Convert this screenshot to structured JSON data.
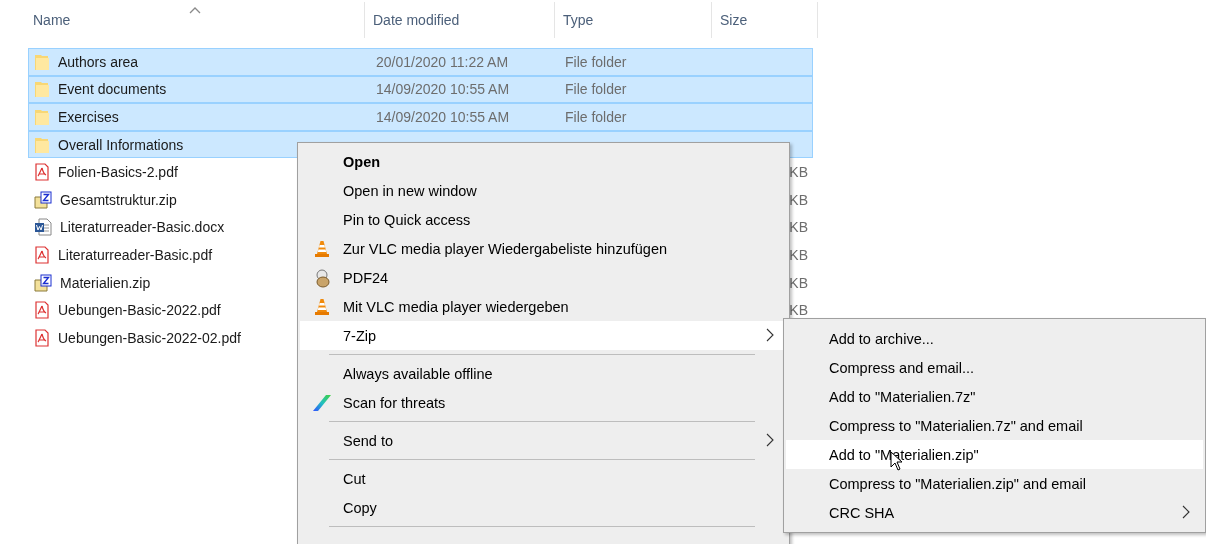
{
  "columns": [
    {
      "label": "Name",
      "sorted": true
    },
    {
      "label": "Date modified",
      "sorted": false
    },
    {
      "label": "Type",
      "sorted": false
    },
    {
      "label": "Size",
      "sorted": false
    }
  ],
  "rows": [
    {
      "kind": "folder",
      "name": "Authors area",
      "date": "20/01/2020 11:22 AM",
      "type": "File folder",
      "selected": true
    },
    {
      "kind": "folder",
      "name": "Event documents",
      "date": "14/09/2020 10:55 AM",
      "type": "File folder",
      "selected": true
    },
    {
      "kind": "folder",
      "name": "Exercises",
      "date": "14/09/2020 10:55 AM",
      "type": "File folder",
      "selected": true
    },
    {
      "kind": "folder",
      "name": "Overall Informations",
      "selected": true
    },
    {
      "kind": "pdf",
      "name": "Folien-Basics-2.pdf",
      "size": "KB",
      "selected": false
    },
    {
      "kind": "zip",
      "name": "Gesamtstruktur.zip",
      "size": "KB",
      "selected": false
    },
    {
      "kind": "word",
      "name": "Literaturreader-Basic.docx",
      "size": "KB",
      "selected": false
    },
    {
      "kind": "pdf",
      "name": "Literaturreader-Basic.pdf",
      "size": "KB",
      "selected": false
    },
    {
      "kind": "zip",
      "name": "Materialien.zip",
      "size": "KB",
      "selected": false
    },
    {
      "kind": "pdf",
      "name": "Uebungen-Basic-2022.pdf",
      "size": "KB",
      "selected": false
    },
    {
      "kind": "pdf",
      "name": "Uebungen-Basic-2022-02.pdf",
      "selected": false
    }
  ],
  "context_menu": {
    "items": [
      {
        "kind": "item",
        "label": "Open",
        "bold": true,
        "submenu": false,
        "highlighted": false
      },
      {
        "kind": "item",
        "label": "Open in new window",
        "bold": false,
        "submenu": false,
        "highlighted": false
      },
      {
        "kind": "item",
        "label": "Pin to Quick access",
        "bold": false,
        "submenu": false,
        "highlighted": false
      },
      {
        "kind": "item",
        "label": "Zur VLC media player Wiedergabeliste hinzufügen",
        "bold": false,
        "submenu": false,
        "highlighted": false
      },
      {
        "kind": "item",
        "label": "PDF24",
        "bold": false,
        "submenu": false,
        "highlighted": false
      },
      {
        "kind": "item",
        "label": "Mit VLC media player wiedergeben",
        "bold": false,
        "submenu": false,
        "highlighted": false
      },
      {
        "kind": "item",
        "label": "7-Zip",
        "bold": false,
        "submenu": true,
        "highlighted": true
      },
      {
        "kind": "separator"
      },
      {
        "kind": "item",
        "label": "Always available offline",
        "bold": false,
        "submenu": false,
        "highlighted": false
      },
      {
        "kind": "item",
        "label": "Scan for threats",
        "bold": false,
        "submenu": false,
        "highlighted": false
      },
      {
        "kind": "separator"
      },
      {
        "kind": "item",
        "label": "Send to",
        "bold": false,
        "submenu": true,
        "highlighted": false
      },
      {
        "kind": "separator"
      },
      {
        "kind": "item",
        "label": "Cut",
        "bold": false,
        "submenu": false,
        "highlighted": false
      },
      {
        "kind": "item",
        "label": "Copy",
        "bold": false,
        "submenu": false,
        "highlighted": false
      },
      {
        "kind": "separator"
      }
    ]
  },
  "submenu": {
    "items": [
      {
        "label": "Add to archive...",
        "submenu": false,
        "highlighted": false
      },
      {
        "label": "Compress and email...",
        "submenu": false,
        "highlighted": false
      },
      {
        "label": "Add to \"Materialien.7z\"",
        "submenu": false,
        "highlighted": false
      },
      {
        "label": "Compress to \"Materialien.7z\" and email",
        "submenu": false,
        "highlighted": false
      },
      {
        "label": "Add to \"Materialien.zip\"",
        "submenu": false,
        "highlighted": true
      },
      {
        "label": "Compress to \"Materialien.zip\" and email",
        "submenu": false,
        "highlighted": false
      },
      {
        "label": "CRC SHA",
        "submenu": true,
        "highlighted": false
      }
    ]
  }
}
